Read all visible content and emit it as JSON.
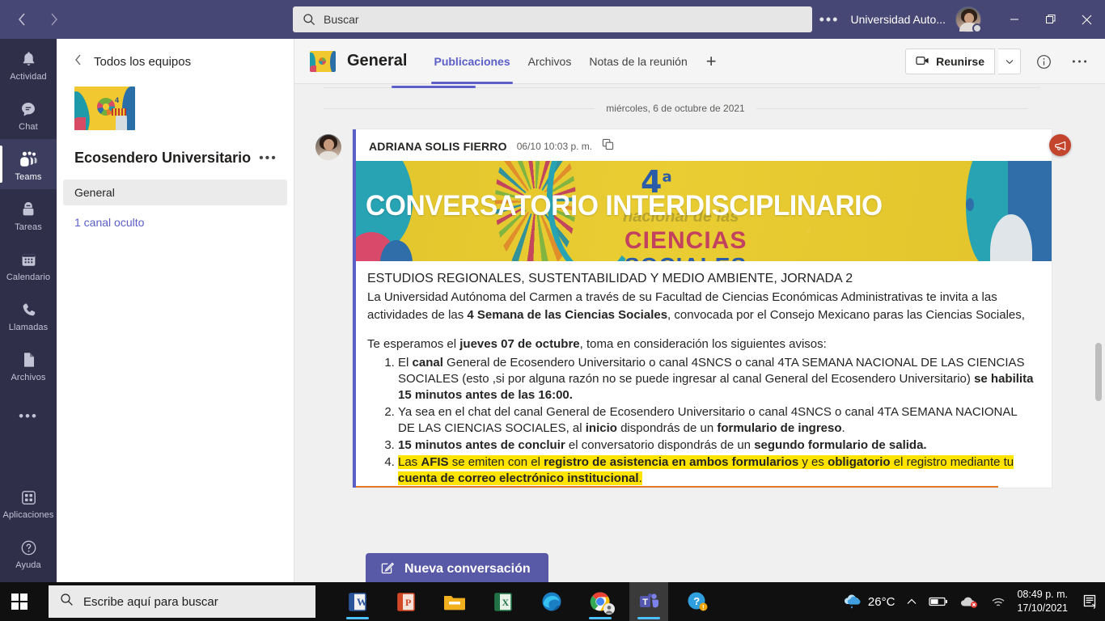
{
  "titlebar": {
    "back_icon": "chevron-left-icon",
    "forward_icon": "chevron-right-icon",
    "search_placeholder": "Buscar",
    "overflow_label": "•••",
    "org_name": "Universidad Auto...",
    "minimize": "—",
    "maximize": "❐",
    "close": "✕"
  },
  "rail": {
    "items": [
      {
        "label": "Actividad",
        "icon": "bell-icon",
        "active": false
      },
      {
        "label": "Chat",
        "icon": "chat-icon",
        "active": false
      },
      {
        "label": "Teams",
        "icon": "teams-icon",
        "active": true
      },
      {
        "label": "Tareas",
        "icon": "tasks-icon",
        "active": false
      },
      {
        "label": "Calendario",
        "icon": "calendar-icon",
        "active": false
      },
      {
        "label": "Llamadas",
        "icon": "phone-icon",
        "active": false
      },
      {
        "label": "Archivos",
        "icon": "file-icon",
        "active": false
      }
    ],
    "more_label": "•••",
    "bottom": [
      {
        "label": "Aplicaciones",
        "icon": "apps-grid-icon"
      },
      {
        "label": "Ayuda",
        "icon": "help-circle-icon"
      }
    ]
  },
  "sidebar": {
    "all_teams_label": "Todos los equipos",
    "team_name": "Ecosendero Universitario",
    "team_options_label": "•••",
    "channels": [
      {
        "label": "General",
        "selected": true
      },
      {
        "label": "1 canal oculto",
        "selected": false
      }
    ]
  },
  "channel_header": {
    "title": "General",
    "tabs": [
      {
        "label": "Publicaciones",
        "active": true
      },
      {
        "label": "Archivos",
        "active": false
      },
      {
        "label": "Notas de la reunión",
        "active": false
      }
    ],
    "add_tab": "+",
    "meet_label": "Reunirse",
    "meet_caret": "⌄",
    "info_icon": "info-circle-icon",
    "more_icon": "more-horizontal-icon"
  },
  "conversation": {
    "date_divider": "miércoles, 6 de octubre de 2021",
    "message": {
      "author": "ADRIANA SOLIS FIERRO",
      "time": "06/10 10:03 p. m.",
      "copy_icon": "copy-icon",
      "announcement_badge_icon": "megaphone-icon",
      "banner": {
        "headline": "CONVERSATORIO INTERDISCIPLINARIO",
        "edition_number": "4",
        "edition_suffix": "a",
        "sub_line": "nacional de las",
        "word_1": "CIENCIAS",
        "word_2": "SOCIALES"
      },
      "heading": "ESTUDIOS REGIONALES, SUSTENTABILIDAD Y MEDIO AMBIENTE, JORNADA 2",
      "para_1_a": "La Universidad Autónoma del Carmen a través de su Facultad de Ciencias Económicas Administrativas te invita a las actividades de las ",
      "para_1_b": "4 Semana de las Ciencias Sociales",
      "para_1_c": ", convocada por el Consejo Mexicano paras las Ciencias Sociales,",
      "para_2_a": "Te esperamos el ",
      "para_2_b": "jueves 07 de octubre",
      "para_2_c": ", toma en consideración los siguientes avisos:",
      "list": [
        {
          "parts": [
            {
              "t": "El ",
              "b": false
            },
            {
              "t": "canal",
              "b": true
            },
            {
              "t": " General de Ecosendero Universitario o canal 4SNCS o canal 4TA SEMANA NACIONAL DE LAS CIENCIAS SOCIALES (esto ,si por alguna razón no se puede ingresar al canal General del Ecosendero Universitario) ",
              "b": false
            },
            {
              "t": "se habilita 15 minutos antes de las 16:00.",
              "b": true
            }
          ]
        },
        {
          "parts": [
            {
              "t": "Ya sea en el chat del canal General de Ecosendero Universitario o canal 4SNCS o canal 4TA SEMANA NACIONAL DE LAS CIENCIAS SOCIALES, al ",
              "b": false
            },
            {
              "t": "inicio",
              "b": true
            },
            {
              "t": " dispondrás de un ",
              "b": false
            },
            {
              "t": "formulario de ingreso",
              "b": true
            },
            {
              "t": ".",
              "b": false
            }
          ]
        },
        {
          "parts": [
            {
              "t": "15 minutos antes de concluir",
              "b": true
            },
            {
              "t": " el conversatorio dispondrás de un ",
              "b": false
            },
            {
              "t": "segundo formulario de salida.",
              "b": true
            }
          ]
        },
        {
          "highlight": true,
          "parts": [
            {
              "t": "Las ",
              "b": false
            },
            {
              "t": "AFIS",
              "b": true
            },
            {
              "t": " se emiten con el ",
              "b": false
            },
            {
              "t": "registro de asistencia en ambos formularios",
              "b": true
            },
            {
              "t": " y es ",
              "b": false
            },
            {
              "t": "obligatorio",
              "b": true
            },
            {
              "t": " el registro mediante tu ",
              "b": false
            },
            {
              "t": "cuenta de correo electrónico institucional",
              "b": true
            },
            {
              "t": ".",
              "b": false
            }
          ]
        }
      ]
    },
    "new_conversation_label": "Nueva conversación",
    "new_conversation_icon": "compose-icon"
  },
  "taskbar": {
    "start_icon": "windows-logo-icon",
    "search_placeholder": "Escribe aquí para buscar",
    "search_icon": "search-icon",
    "apps": [
      {
        "name": "word-icon",
        "active": true
      },
      {
        "name": "powerpoint-icon",
        "active": false
      },
      {
        "name": "file-explorer-icon",
        "active": false
      },
      {
        "name": "excel-icon",
        "active": false
      },
      {
        "name": "edge-icon",
        "active": false
      },
      {
        "name": "chrome-icon",
        "active": true
      },
      {
        "name": "teams-icon",
        "active": true,
        "focused": true
      },
      {
        "name": "help-icon",
        "active": false
      }
    ],
    "weather_icon": "rain-cloud-icon",
    "weather_temp": "26°C",
    "chevron_up": "∧",
    "battery_icon": "battery-icon",
    "onedrive_icon": "onedrive-error-icon",
    "wifi_icon": "wifi-icon",
    "time": "08:49 p. m.",
    "date": "17/10/2021",
    "notification_icon": "notification-icon"
  },
  "colors": {
    "teams_purple": "#464775",
    "accent": "#5b5fc7",
    "rail_bg": "#2f2f4a",
    "highlight_yellow": "#ffe400",
    "announcement_red": "#c4452e",
    "orange_rule": "#e07a2a"
  }
}
